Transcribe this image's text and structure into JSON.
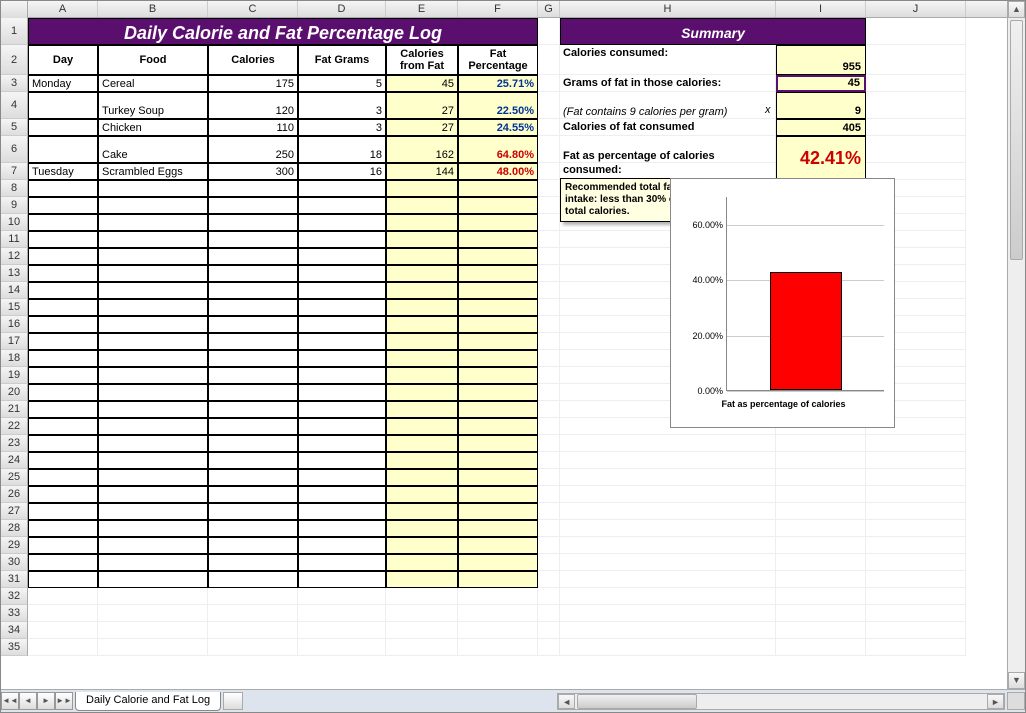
{
  "columns": {
    "letters": [
      "A",
      "B",
      "C",
      "D",
      "E",
      "F",
      "G",
      "H",
      "I",
      "J"
    ],
    "widths": [
      70,
      110,
      90,
      88,
      72,
      80,
      22,
      216,
      90,
      100
    ]
  },
  "rows": {
    "count": 35,
    "heights": {
      "1": 27,
      "2": 30,
      "4": 27,
      "6": 27
    }
  },
  "title": "Daily Calorie and Fat Percentage Log",
  "summary_title": "Summary",
  "headers": {
    "day": "Day",
    "food": "Food",
    "calories": "Calories",
    "fatgrams": "Fat Grams",
    "calfromfat": "Calories from Fat",
    "fatpct": "Fat Percentage"
  },
  "log": [
    {
      "row": 3,
      "day": "Monday",
      "food": "Cereal",
      "cal": "175",
      "fg": "5",
      "cff": "45",
      "pct": "25.71%",
      "pct_red": false
    },
    {
      "row": 4,
      "day": "",
      "food": "Turkey Soup",
      "cal": "120",
      "fg": "3",
      "cff": "27",
      "pct": "22.50%",
      "pct_red": false
    },
    {
      "row": 5,
      "day": "",
      "food": "Chicken",
      "cal": "110",
      "fg": "3",
      "cff": "27",
      "pct": "24.55%",
      "pct_red": false
    },
    {
      "row": 6,
      "day": "",
      "food": "Cake",
      "cal": "250",
      "fg": "18",
      "cff": "162",
      "pct": "64.80%",
      "pct_red": true
    },
    {
      "row": 7,
      "day": "Tuesday",
      "food": "Scrambled Eggs",
      "cal": "300",
      "fg": "16",
      "cff": "144",
      "pct": "48.00%",
      "pct_red": true
    }
  ],
  "empty_rows": [
    8,
    9,
    10,
    11,
    12,
    13,
    14,
    15,
    16,
    17,
    18,
    19,
    20,
    21,
    22,
    23,
    24,
    25,
    26,
    27,
    28,
    29,
    30,
    31
  ],
  "summary": {
    "cal_consumed_label": "Calories consumed:",
    "cal_consumed_value": "955",
    "grams_label": "Grams of fat in those calories:",
    "grams_value": "45",
    "note": "(Fat contains 9 calories per gram)",
    "x_label": "x",
    "nine": "9",
    "calfat_label": "Calories of fat consumed",
    "calfat_value": "405",
    "pct_label1": "Fat as percentage of calories",
    "pct_label2": "consumed:",
    "pct_value": "42.41%"
  },
  "comment": "Recommended total fat intake: less than 30% of total calories.",
  "chart_data": {
    "type": "bar",
    "categories": [
      "Fat as percentage of calories"
    ],
    "values": [
      42.41
    ],
    "xlabel": "Fat as percentage of calories",
    "ylabel": "",
    "ylim": [
      0,
      70
    ],
    "yticks": [
      "0.00%",
      "20.00%",
      "40.00%",
      "60.00%"
    ]
  },
  "tab": "Daily Calorie and Fat Log",
  "nav": {
    "first": "◄◄",
    "prev": "◄",
    "next": "►",
    "last": "►►",
    "left": "◄",
    "right": "►",
    "up": "▲",
    "down": "▼"
  }
}
